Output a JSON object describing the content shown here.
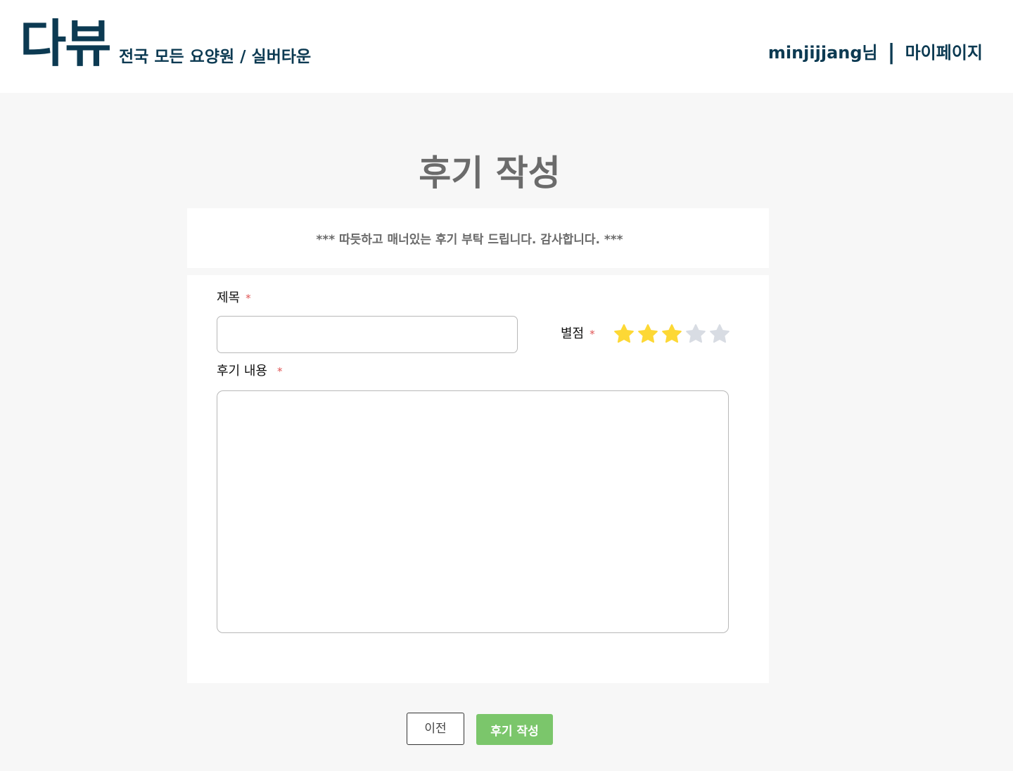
{
  "header": {
    "logo": "다뷰",
    "tagline": "전국 모든 요양원 / 실버타운",
    "user_name": "minjijjang님",
    "separator": "|",
    "mypage_link": "마이페이지"
  },
  "page": {
    "title": "후기 작성",
    "notice": "*** 따듯하고 매너있는 후기 부탁 드립니다. 감사합니다. ***"
  },
  "form": {
    "title_label": "제목",
    "title_value": "",
    "rating_label": "별점",
    "rating_value": 3,
    "rating_max": 5,
    "content_label": "후기 내용",
    "content_value": "",
    "required_mark": "*"
  },
  "buttons": {
    "prev_label": "이전",
    "submit_label": "후기 작성"
  },
  "colors": {
    "brand": "#0c3a52",
    "star_filled": "#fdd835",
    "star_empty": "#d8dce3",
    "submit_bg": "#7bc66b",
    "required": "#e05555"
  },
  "icons": {
    "star": "star-icon"
  }
}
